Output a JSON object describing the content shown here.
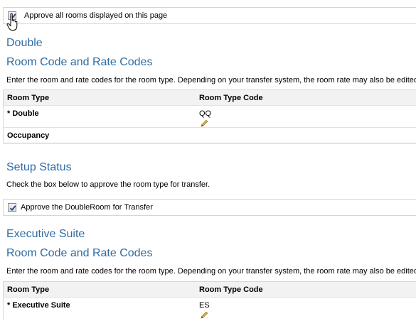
{
  "approve_all": {
    "label": "Approve all rooms displayed on this page",
    "checked": true
  },
  "sections": [
    {
      "room_name": "Double",
      "codes_heading": "Room Code and Rate Codes",
      "codes_description": "Enter the room and rate codes for the room type. Depending on your transfer system, the room rate may also be edited.",
      "table": {
        "headers": [
          "Room Type",
          "Room Type Code"
        ],
        "row": {
          "room_type": "* Double",
          "code": "QQ"
        },
        "occupancy_label": "Occupancy"
      },
      "setup_heading": "Setup Status",
      "setup_description": "Check the box below to approve the room type for transfer.",
      "approve_label": "Approve the DoubleRoom for Transfer",
      "approve_checked": true
    },
    {
      "room_name": "Executive Suite",
      "codes_heading": "Room Code and Rate Codes",
      "codes_description": "Enter the room and rate codes for the room type. Depending on your transfer system, the room rate may also be edited.",
      "table": {
        "headers": [
          "Room Type",
          "Room Type Code"
        ],
        "row": {
          "room_type": "* Executive Suite",
          "code": "ES"
        }
      }
    }
  ],
  "colors": {
    "heading": "#2e6ca4",
    "border": "#d6d6d6",
    "header_bg": "#f2f2f2"
  },
  "icons": {
    "checkbox": "checkmark-icon",
    "edit": "pencil-icon",
    "cursor": "hand-cursor-icon"
  }
}
